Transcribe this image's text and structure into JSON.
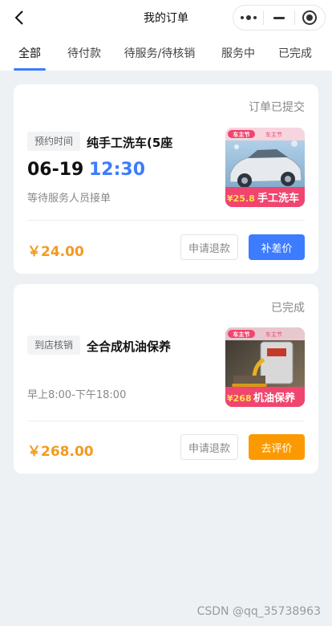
{
  "header": {
    "title": "我的订单"
  },
  "tabs": [
    {
      "label": "全部",
      "active": true
    },
    {
      "label": "待付款",
      "active": false
    },
    {
      "label": "待服务/待核销",
      "active": false
    },
    {
      "label": "服务中",
      "active": false
    },
    {
      "label": "已完成",
      "active": false
    }
  ],
  "orders": [
    {
      "status": "订单已提交",
      "tag": "预约时间",
      "service": "纯手工洗车(5座",
      "date": "06-19",
      "time": "12:30",
      "note": "等待服务人员接单",
      "price": "￥24.00",
      "secondary_button": "申请退款",
      "primary_button": "补差价",
      "image": {
        "badge": "车主节",
        "promo_price": "¥25.8",
        "promo_label": "手工洗车",
        "brand": "车主节"
      }
    },
    {
      "status": "已完成",
      "tag": "到店核销",
      "service": "全合成机油保养",
      "hours": "早上8:00-下午18:00",
      "price": "￥268.00",
      "secondary_button": "申请退款",
      "primary_button": "去评价",
      "image": {
        "badge": "车主节",
        "promo_price": "¥268",
        "promo_label": "机油保养",
        "brand": "车主节"
      }
    }
  ],
  "watermark": "CSDN @qq_35738963",
  "colors": {
    "accent_blue": "#3d7cff",
    "accent_orange": "#fb9a00",
    "price_orange": "#f39a1e",
    "background": "#eef1f4",
    "promo_pink": "#f0456e"
  }
}
